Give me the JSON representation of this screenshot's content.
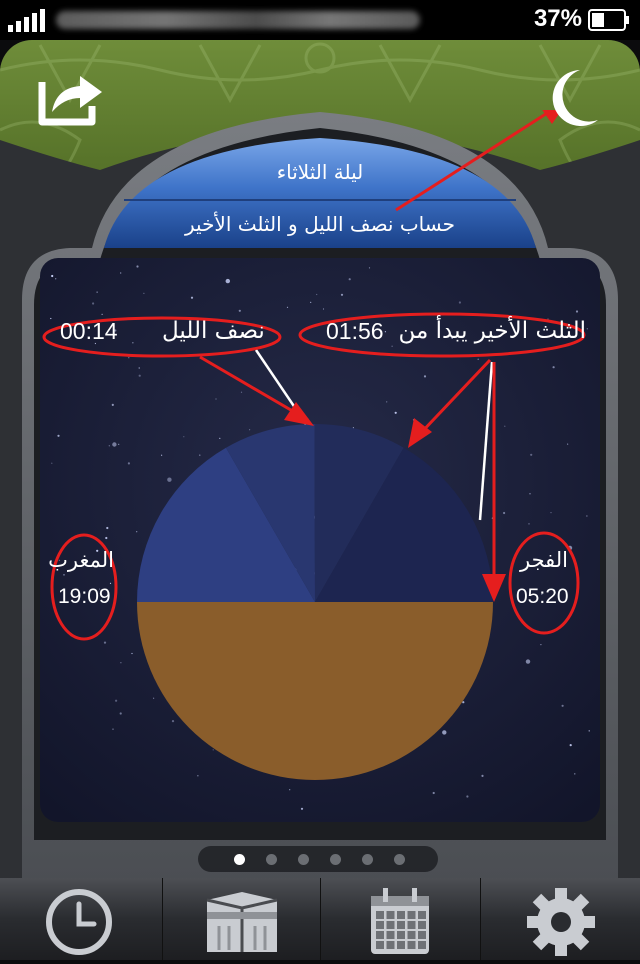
{
  "status_bar": {
    "battery_percent": "37%"
  },
  "header": {
    "night_title": "ليلة الثلاثاء",
    "calc_title": "حساب نصف الليل و الثلث الأخير"
  },
  "night": {
    "midnight": {
      "label": "نصف الليل",
      "time": "00:14"
    },
    "last_third": {
      "label": "الثلث الأخير يبدأ من",
      "time": "01:56"
    },
    "maghrib": {
      "label": "المغرب",
      "time": "19:09"
    },
    "fajr": {
      "label": "الفجر",
      "time": "05:20"
    }
  },
  "pager": {
    "count": 6,
    "active_index": 0
  },
  "tabs": [
    {
      "icon": "clock-icon",
      "active": true
    },
    {
      "icon": "kaaba-icon",
      "active": false
    },
    {
      "icon": "calendar-icon",
      "active": false
    },
    {
      "icon": "gear-icon",
      "active": false
    }
  ],
  "colors": {
    "frame_green": "#58742a",
    "banner_blue": "#2f5fb4",
    "night_sky": "#1b1f38",
    "earth": "#8a5d2b",
    "annotation_red": "#e51e1e"
  }
}
